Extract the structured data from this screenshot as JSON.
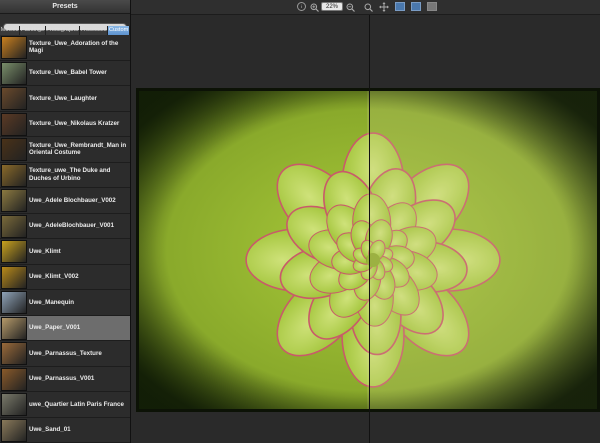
{
  "sidebar": {
    "title": "Presets",
    "search": {
      "placeholder": ""
    },
    "tabs": [
      {
        "label": "Movies"
      },
      {
        "label": "Paintings"
      },
      {
        "label": "Photographs"
      },
      {
        "label": "Processes"
      },
      {
        "label": "Custom"
      }
    ],
    "active_tab": "Custom",
    "items": [
      {
        "label": "Texture_Uwe_Adoration of the Magi",
        "thumb_color": "#c9801f"
      },
      {
        "label": "Texture_Uwe_Babel Tower",
        "thumb_color": "#7a8f6a"
      },
      {
        "label": "Texture_Uwe_Laughter",
        "thumb_color": "#6b4a2c"
      },
      {
        "label": "Texture_Uwe_Nikolaus Kratzer",
        "thumb_color": "#5b3a24"
      },
      {
        "label": "Texture_Uwe_Rembrandt_Man in Oriental Costume",
        "thumb_color": "#4a3218"
      },
      {
        "label": "Texture_uwe_The Duke and Duches of Urbino",
        "thumb_color": "#8a6a2a"
      },
      {
        "label": "Uwe_Adele Blochbauer_V002",
        "thumb_color": "#8c7a40"
      },
      {
        "label": "Uwe_AdeleBlochbauer_V001",
        "thumb_color": "#7a6a3a"
      },
      {
        "label": "Uwe_Klimt",
        "thumb_color": "#c9a21e"
      },
      {
        "label": "Uwe_Klimt_V002",
        "thumb_color": "#b88a1a"
      },
      {
        "label": "Uwe_Manequin",
        "thumb_color": "#8fa3b8"
      },
      {
        "label": "Uwe_Paper_V001",
        "thumb_color": "#b59a6a"
      },
      {
        "label": "Uwe_Parnassus_Texture",
        "thumb_color": "#9a6a3a"
      },
      {
        "label": "Uwe_Parnassus_V001",
        "thumb_color": "#8a5a2a"
      },
      {
        "label": "uwe_Quartier Latin Paris France",
        "thumb_color": "#7a7a6a"
      },
      {
        "label": "Uwe_Sand_01",
        "thumb_color": "#8a7a5a"
      }
    ],
    "selected_item": "Uwe_Paper_V001"
  },
  "toolbar": {
    "zoom_value": "22%",
    "buttons": [
      "info-icon",
      "zoom-in-icon",
      "zoom-out-icon",
      "zoom-fit-icon",
      "pan-icon",
      "single-view-icon",
      "split-view-icon",
      "side-by-side-icon"
    ]
  },
  "colors": {
    "accent": "#5e93cf",
    "leaf": "#9cc23a",
    "leaf_edge": "#c95a6a"
  }
}
